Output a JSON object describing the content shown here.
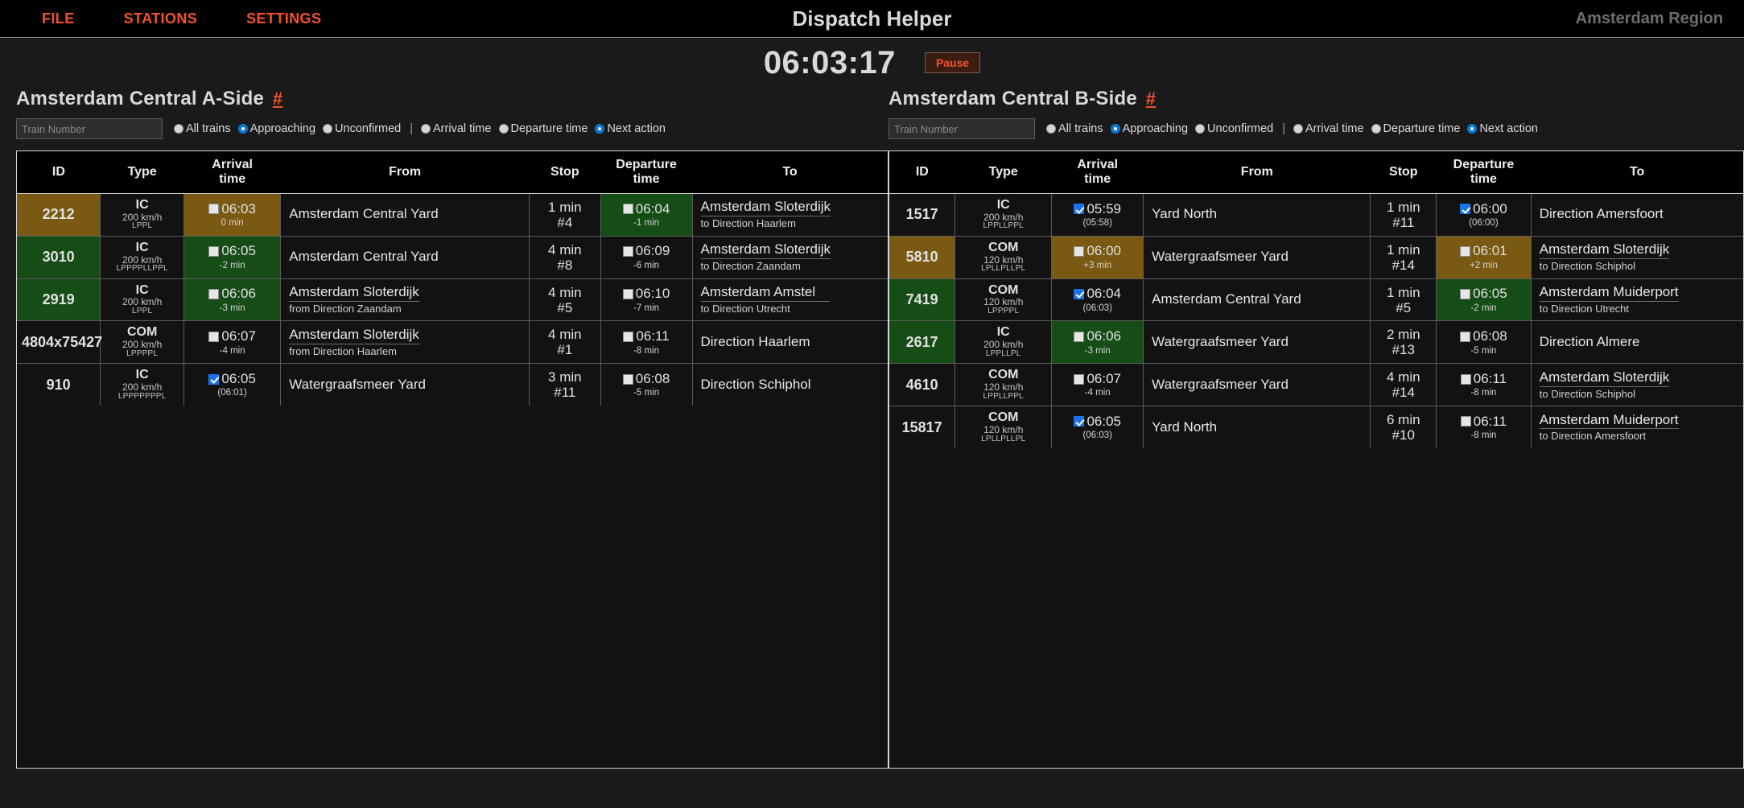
{
  "menubar": {
    "items": [
      {
        "label": "FILE",
        "name": "menu-file"
      },
      {
        "label": "STATIONS",
        "name": "menu-stations"
      },
      {
        "label": "SETTINGS",
        "name": "menu-settings"
      }
    ],
    "app_title": "Dispatch Helper",
    "region": "Amsterdam Region",
    "accent_color": "#f4512c"
  },
  "clockbar": {
    "time": "06:03:17",
    "pause_label": "Pause"
  },
  "filter_options": {
    "scope": [
      {
        "label": "All trains",
        "selected": false
      },
      {
        "label": "Approaching",
        "selected": true
      },
      {
        "label": "Unconfirmed",
        "selected": false
      }
    ],
    "separator": "|",
    "sort": [
      {
        "label": "Arrival time",
        "selected": false
      },
      {
        "label": "Departure time",
        "selected": false
      },
      {
        "label": "Next action",
        "selected": true
      }
    ],
    "input_placeholder": "Train Number",
    "input_value": ""
  },
  "columns": [
    "ID",
    "Type",
    "Arrival\ntime",
    "From",
    "Stop",
    "Departure\ntime",
    "To"
  ],
  "column_labels": {
    "id": "ID",
    "type": "Type",
    "arrival_1": "Arrival",
    "arrival_2": "time",
    "from": "From",
    "stop": "Stop",
    "departure_1": "Departure",
    "departure_2": "time",
    "to": "To"
  },
  "panels": [
    {
      "title": "Amsterdam Central A-Side",
      "hash": "#",
      "rows": [
        {
          "id": "2212",
          "id_bg": "gold",
          "type": "IC",
          "speed": "200 km/h",
          "code": "LPPL",
          "arr_time": "06:03",
          "arr_sub": "0 min",
          "arr_checked": false,
          "arr_bg": "gold",
          "from_main": "Amsterdam Central Yard",
          "from_sub": "",
          "from_underline": false,
          "stop_dur": "1 min",
          "stop_plat": "#4",
          "dep_time": "06:04",
          "dep_sub": "-1 min",
          "dep_checked": false,
          "dep_bg": "green",
          "to_main": "Amsterdam Sloterdijk",
          "to_sub": "to Direction Haarlem",
          "to_underline": true
        },
        {
          "id": "3010",
          "id_bg": "green",
          "type": "IC",
          "speed": "200 km/h",
          "code": "LPPPPLLPPL",
          "arr_time": "06:05",
          "arr_sub": "-2 min",
          "arr_checked": false,
          "arr_bg": "green",
          "from_main": "Amsterdam Central Yard",
          "from_sub": "",
          "from_underline": false,
          "stop_dur": "4 min",
          "stop_plat": "#8",
          "dep_time": "06:09",
          "dep_sub": "-6 min",
          "dep_checked": false,
          "dep_bg": "none",
          "to_main": "Amsterdam Sloterdijk",
          "to_sub": "to Direction Zaandam",
          "to_underline": true
        },
        {
          "id": "2919",
          "id_bg": "green",
          "type": "IC",
          "speed": "200 km/h",
          "code": "LPPL",
          "arr_time": "06:06",
          "arr_sub": "-3 min",
          "arr_checked": false,
          "arr_bg": "green",
          "from_main": "Amsterdam Sloterdijk",
          "from_sub": "from Direction Zaandam",
          "from_underline": true,
          "stop_dur": "4 min",
          "stop_plat": "#5",
          "dep_time": "06:10",
          "dep_sub": "-7 min",
          "dep_checked": false,
          "dep_bg": "none",
          "to_main": "Amsterdam Amstel",
          "to_sub": "to Direction Utrecht",
          "to_underline": true
        },
        {
          "id": "4804x75427",
          "id_bg": "none",
          "type": "COM",
          "speed": "200 km/h",
          "code": "LPPPPL",
          "arr_time": "06:07",
          "arr_sub": "-4 min",
          "arr_checked": false,
          "arr_bg": "none",
          "from_main": "Amsterdam Sloterdijk",
          "from_sub": "from Direction Haarlem",
          "from_underline": true,
          "stop_dur": "4 min",
          "stop_plat": "#1",
          "dep_time": "06:11",
          "dep_sub": "-8 min",
          "dep_checked": false,
          "dep_bg": "none",
          "to_main": "Direction Haarlem",
          "to_sub": "",
          "to_underline": false
        },
        {
          "id": "910",
          "id_bg": "none",
          "type": "IC",
          "speed": "200 km/h",
          "code": "LPPPPPPPL",
          "arr_time": "06:05",
          "arr_sub": "(06:01)",
          "arr_checked": true,
          "arr_bg": "none",
          "from_main": "Watergraafsmeer Yard",
          "from_sub": "",
          "from_underline": false,
          "stop_dur": "3 min",
          "stop_plat": "#11",
          "dep_time": "06:08",
          "dep_sub": "-5 min",
          "dep_checked": false,
          "dep_bg": "none",
          "to_main": "Direction Schiphol",
          "to_sub": "",
          "to_underline": false
        }
      ]
    },
    {
      "title": "Amsterdam Central B-Side",
      "hash": "#",
      "rows": [
        {
          "id": "1517",
          "id_bg": "none",
          "type": "IC",
          "speed": "200 km/h",
          "code": "LPPLLPPL",
          "arr_time": "05:59",
          "arr_sub": "(05:58)",
          "arr_checked": true,
          "arr_bg": "none",
          "from_main": "Yard North",
          "from_sub": "",
          "from_underline": false,
          "stop_dur": "1 min",
          "stop_plat": "#11",
          "dep_time": "06:00",
          "dep_sub": "(06:00)",
          "dep_checked": true,
          "dep_bg": "none",
          "to_main": "Direction Amersfoort",
          "to_sub": "",
          "to_underline": false
        },
        {
          "id": "5810",
          "id_bg": "gold",
          "type": "COM",
          "speed": "120 km/h",
          "code": "LPLLPLLPL",
          "arr_time": "06:00",
          "arr_sub": "+3 min",
          "arr_checked": false,
          "arr_bg": "gold",
          "from_main": "Watergraafsmeer Yard",
          "from_sub": "",
          "from_underline": false,
          "stop_dur": "1 min",
          "stop_plat": "#14",
          "dep_time": "06:01",
          "dep_sub": "+2 min",
          "dep_checked": false,
          "dep_bg": "gold",
          "to_main": "Amsterdam Sloterdijk",
          "to_sub": "to Direction Schiphol",
          "to_underline": true
        },
        {
          "id": "7419",
          "id_bg": "green",
          "type": "COM",
          "speed": "120 km/h",
          "code": "LPPPPL",
          "arr_time": "06:04",
          "arr_sub": "(06:03)",
          "arr_checked": true,
          "arr_bg": "none",
          "from_main": "Amsterdam Central Yard",
          "from_sub": "",
          "from_underline": false,
          "stop_dur": "1 min",
          "stop_plat": "#5",
          "dep_time": "06:05",
          "dep_sub": "-2 min",
          "dep_checked": false,
          "dep_bg": "green",
          "to_main": "Amsterdam Muiderport",
          "to_sub": "to Direction Utrecht",
          "to_underline": true
        },
        {
          "id": "2617",
          "id_bg": "green",
          "type": "IC",
          "speed": "200 km/h",
          "code": "LPPLLPL",
          "arr_time": "06:06",
          "arr_sub": "-3 min",
          "arr_checked": false,
          "arr_bg": "green",
          "from_main": "Watergraafsmeer Yard",
          "from_sub": "",
          "from_underline": false,
          "stop_dur": "2 min",
          "stop_plat": "#13",
          "dep_time": "06:08",
          "dep_sub": "-5 min",
          "dep_checked": false,
          "dep_bg": "none",
          "to_main": "Direction Almere",
          "to_sub": "",
          "to_underline": false
        },
        {
          "id": "4610",
          "id_bg": "none",
          "type": "COM",
          "speed": "120 km/h",
          "code": "LPPLLPPL",
          "arr_time": "06:07",
          "arr_sub": "-4 min",
          "arr_checked": false,
          "arr_bg": "none",
          "from_main": "Watergraafsmeer Yard",
          "from_sub": "",
          "from_underline": false,
          "stop_dur": "4 min",
          "stop_plat": "#14",
          "dep_time": "06:11",
          "dep_sub": "-8 min",
          "dep_checked": false,
          "dep_bg": "none",
          "to_main": "Amsterdam Sloterdijk",
          "to_sub": "to Direction Schiphol",
          "to_underline": true
        },
        {
          "id": "15817",
          "id_bg": "none",
          "type": "COM",
          "speed": "120 km/h",
          "code": "LPLLPLLPL",
          "arr_time": "06:05",
          "arr_sub": "(06:03)",
          "arr_checked": true,
          "arr_bg": "none",
          "from_main": "Yard North",
          "from_sub": "",
          "from_underline": false,
          "stop_dur": "6 min",
          "stop_plat": "#10",
          "dep_time": "06:11",
          "dep_sub": "-8 min",
          "dep_checked": false,
          "dep_bg": "none",
          "to_main": "Amsterdam Muiderport",
          "to_sub": "to Direction Amersfoort",
          "to_underline": true
        }
      ]
    }
  ]
}
